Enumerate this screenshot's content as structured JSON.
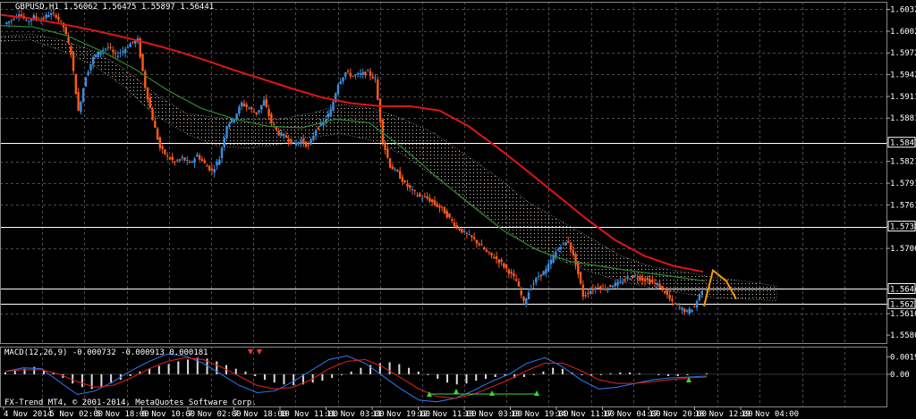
{
  "header": {
    "symbol_info": "GBPUSD,H1  1.56062 1.56475 1.55897 1.56441"
  },
  "indicator": {
    "macd_label": "MACD(12,26,9) -0.000732 -0.000913 0.000181"
  },
  "watermark": "FX-Trend MT4, © 2001-2014, MetaQuotes Software Corp.",
  "colors": {
    "background": "#000000",
    "grid": "#4a4a4a",
    "bull_candle": "#3a8fe0",
    "bear_candle": "#ff5a1e",
    "ma_slow": "#e01515",
    "ma_fast": "#2e8b2e",
    "cloud": "#e8d6c8",
    "forecast": "#ff9900",
    "hline": "#ffffff"
  },
  "chart_data": [
    {
      "type": "candlestick",
      "name": "price",
      "y_ticks": [
        "1.60325",
        "1.60020",
        "1.59720",
        "1.59420",
        "1.59115",
        "1.58815",
        "1.58473",
        "1.58215",
        "1.57910",
        "1.57610",
        "1.57308",
        "1.57005",
        "1.56441",
        "1.56232",
        "1.56100",
        "1.55800"
      ],
      "ylim": [
        1.5569,
        1.6043
      ],
      "x_ticks": [
        "4 Nov 2014",
        "5 Nov 02:00",
        "5 Nov 18:00",
        "6 Nov 10:00",
        "7 Nov 02:00",
        "7 Nov 18:00",
        "10 Nov 11:00",
        "11 Nov 03:00",
        "11 Nov 19:00",
        "12 Nov 11:00",
        "13 Nov 03:00",
        "13 Nov 19:00",
        "14 Nov 11:00",
        "17 Nov 04:00",
        "17 Nov 20:00",
        "18 Nov 12:00",
        "19 Nov 04:00"
      ],
      "horizontal_levels": [
        {
          "value": 1.58473,
          "label": "1.58473"
        },
        {
          "value": 1.57308,
          "label": "1.57308"
        },
        {
          "value": 1.56441,
          "label": "1.56441"
        },
        {
          "value": 1.56232,
          "label": "1.56232"
        }
      ],
      "close_path": [
        1.6012,
        1.6018,
        1.6028,
        1.6015,
        1.6022,
        1.6018,
        1.6026,
        1.6024,
        1.6008,
        1.5972,
        1.589,
        1.594,
        1.5965,
        1.5975,
        1.598,
        1.5968,
        1.5975,
        1.5985,
        1.599,
        1.5925,
        1.588,
        1.584,
        1.5828,
        1.582,
        1.5826,
        1.5818,
        1.583,
        1.5818,
        1.5808,
        1.5825,
        1.5872,
        1.5882,
        1.5902,
        1.5895,
        1.5888,
        1.5905,
        1.5875,
        1.586,
        1.5855,
        1.5845,
        1.585,
        1.5842,
        1.5866,
        1.5875,
        1.5892,
        1.593,
        1.5945,
        1.594,
        1.5942,
        1.5945,
        1.5935,
        1.585,
        1.5815,
        1.5805,
        1.579,
        1.578,
        1.5772,
        1.577,
        1.5762,
        1.5755,
        1.5742,
        1.573,
        1.5722,
        1.5715,
        1.5706,
        1.5695,
        1.5688,
        1.568,
        1.5668,
        1.5655,
        1.5625,
        1.5648,
        1.5662,
        1.567,
        1.569,
        1.5705,
        1.571,
        1.568,
        1.5635,
        1.5642,
        1.5648,
        1.5645,
        1.565,
        1.5652,
        1.566,
        1.5662,
        1.5658,
        1.5655,
        1.565,
        1.564,
        1.5625,
        1.5618,
        1.5612,
        1.562,
        1.5644
      ],
      "ma_slow": [
        1.6025,
        1.602,
        1.6013,
        1.6005,
        1.5996,
        1.5986,
        1.5975,
        1.5962,
        1.5948,
        1.5935,
        1.5922,
        1.591,
        1.5902,
        1.5898,
        1.5898,
        1.5892,
        1.587,
        1.584,
        1.5808,
        1.5775,
        1.5742,
        1.5712,
        1.569,
        1.5676,
        1.5668
      ],
      "ma_fast": [
        1.601,
        1.6008,
        1.5996,
        1.5975,
        1.595,
        1.592,
        1.5895,
        1.588,
        1.587,
        1.5868,
        1.588,
        1.5875,
        1.584,
        1.58,
        1.5762,
        1.5725,
        1.5698,
        1.5682,
        1.5675,
        1.5668,
        1.5662,
        1.5655
      ],
      "cloud_upper": [
        1.5995,
        1.5998,
        1.599,
        1.5975,
        1.595,
        1.5915,
        1.5888,
        1.5882,
        1.588,
        1.588,
        1.5888,
        1.59,
        1.5895,
        1.588,
        1.586,
        1.583,
        1.58,
        1.5765,
        1.574,
        1.5715,
        1.569,
        1.5675,
        1.5668,
        1.566,
        1.5655,
        1.5648
      ],
      "cloud_lower": [
        1.5988,
        1.599,
        1.5975,
        1.5955,
        1.5925,
        1.5885,
        1.586,
        1.5842,
        1.584,
        1.5845,
        1.5855,
        1.586,
        1.585,
        1.583,
        1.58,
        1.5768,
        1.5735,
        1.5705,
        1.5685,
        1.5668,
        1.5655,
        1.5645,
        1.5638,
        1.5632,
        1.563,
        1.5628
      ],
      "forecast_path": [
        1.562,
        1.567,
        1.5655,
        1.563
      ]
    },
    {
      "type": "histogram",
      "name": "MACD(12,26,9)",
      "y_ticks": [
        "0.001904",
        "0.00"
      ],
      "ylim": [
        -0.0035,
        0.003
      ],
      "histogram": [
        0.0002,
        0.0004,
        0.0006,
        0.0008,
        0.0005,
        0.0002,
        -0.0004,
        -0.001,
        -0.0014,
        -0.0016,
        -0.0014,
        -0.001,
        -0.0006,
        -0.0002,
        0.0003,
        0.0006,
        0.0009,
        0.0011,
        0.0014,
        0.0016,
        0.0018,
        0.0017,
        0.0014,
        0.001,
        0.0006,
        0.0003,
        -0.0002,
        -0.0006,
        -0.0009,
        -0.0011,
        -0.0012,
        -0.0011,
        -0.0009,
        -0.0007,
        -0.0004,
        -0.0001,
        0.0003,
        0.0007,
        0.001,
        0.0012,
        0.0013,
        0.0011,
        0.0007,
        0.0003,
        -0.0001,
        -0.0005,
        -0.0009,
        -0.0011,
        -0.001,
        -0.0007,
        -0.0005,
        -0.0003,
        -0.0002,
        -0.0004,
        -0.0003,
        -0.0001,
        0.0003,
        0.0007,
        0.0006,
        0.0002,
        -0.0001,
        -0.0002,
        -0.0001,
        0.0001,
        0.0002,
        0.0002,
        0.0001,
        0.0,
        -0.0001,
        -0.0002,
        -0.0002,
        -0.0001,
        0.0,
        0.0001
      ],
      "macd_line": [
        0.0003,
        0.0007,
        0.0006,
        -0.0008,
        -0.0022,
        -0.0018,
        -0.0008,
        0.0004,
        0.0014,
        0.0022,
        0.002,
        0.0012,
        0.0,
        -0.0012,
        -0.002,
        -0.0018,
        -0.0008,
        0.0004,
        0.0016,
        0.002,
        0.0012,
        -0.0002,
        -0.0016,
        -0.0028,
        -0.003,
        -0.0026,
        -0.0018,
        -0.0008,
        0.0,
        0.0012,
        0.0018,
        0.0008,
        -0.0006,
        -0.0016,
        -0.0014,
        -0.001,
        -0.0006,
        -0.0004,
        -0.0003,
        -0.0002
      ],
      "signal_line": [
        0.0003,
        0.0005,
        0.0005,
        0.0,
        -0.0008,
        -0.0014,
        -0.0012,
        -0.0004,
        0.0006,
        0.0014,
        0.0018,
        0.0016,
        0.0008,
        -0.0002,
        -0.0012,
        -0.0016,
        -0.0014,
        -0.0006,
        0.0006,
        0.0014,
        0.0016,
        0.0008,
        -0.0004,
        -0.0016,
        -0.0024,
        -0.0026,
        -0.0022,
        -0.0014,
        -0.0006,
        0.0004,
        0.0012,
        0.0012,
        0.0004,
        -0.0006,
        -0.001,
        -0.001,
        -0.0008,
        -0.0006,
        -0.0004,
        -0.0003
      ]
    }
  ]
}
